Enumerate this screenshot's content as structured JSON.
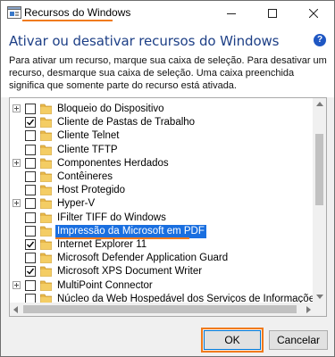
{
  "window": {
    "title": "Recursos do Windows",
    "minimize_glyph": "—",
    "maximize_glyph": "☐",
    "close_glyph": "✕"
  },
  "header": {
    "heading": "Ativar ou desativar recursos do Windows",
    "description": "Para ativar um recurso, marque sua caixa de seleção. Para desativar um recurso, desmarque sua caixa de seleção. Uma caixa preenchida significa que somente parte do recurso está ativada.",
    "help_glyph": "?"
  },
  "features": [
    {
      "label": "Bloqueio do Dispositivo",
      "expandable": true,
      "checked": false
    },
    {
      "label": "Cliente de Pastas de Trabalho",
      "expandable": false,
      "checked": true
    },
    {
      "label": "Cliente Telnet",
      "expandable": false,
      "checked": false
    },
    {
      "label": "Cliente TFTP",
      "expandable": false,
      "checked": false
    },
    {
      "label": "Componentes Herdados",
      "expandable": true,
      "checked": false
    },
    {
      "label": "Contêineres",
      "expandable": false,
      "checked": false
    },
    {
      "label": "Host Protegido",
      "expandable": false,
      "checked": false
    },
    {
      "label": "Hyper-V",
      "expandable": true,
      "checked": false
    },
    {
      "label": "IFilter TIFF do Windows",
      "expandable": false,
      "checked": false
    },
    {
      "label": "Impressão da Microsoft em PDF",
      "expandable": false,
      "checked": false,
      "selected": true
    },
    {
      "label": "Internet Explorer 11",
      "expandable": false,
      "checked": true
    },
    {
      "label": "Microsoft Defender Application Guard",
      "expandable": false,
      "checked": false
    },
    {
      "label": "Microsoft XPS Document Writer",
      "expandable": false,
      "checked": true
    },
    {
      "label": "MultiPoint Connector",
      "expandable": true,
      "checked": false
    },
    {
      "label": "Núcleo da Web Hospedável dos Serviços de Informações da Intern",
      "expandable": false,
      "checked": false
    }
  ],
  "buttons": {
    "ok": "OK",
    "cancel": "Cancelar"
  },
  "colors": {
    "highlight_annotation": "#f07a1c",
    "heading": "#1d3f86",
    "selection": "#1a6fe0",
    "folder": "#e8b84a"
  }
}
